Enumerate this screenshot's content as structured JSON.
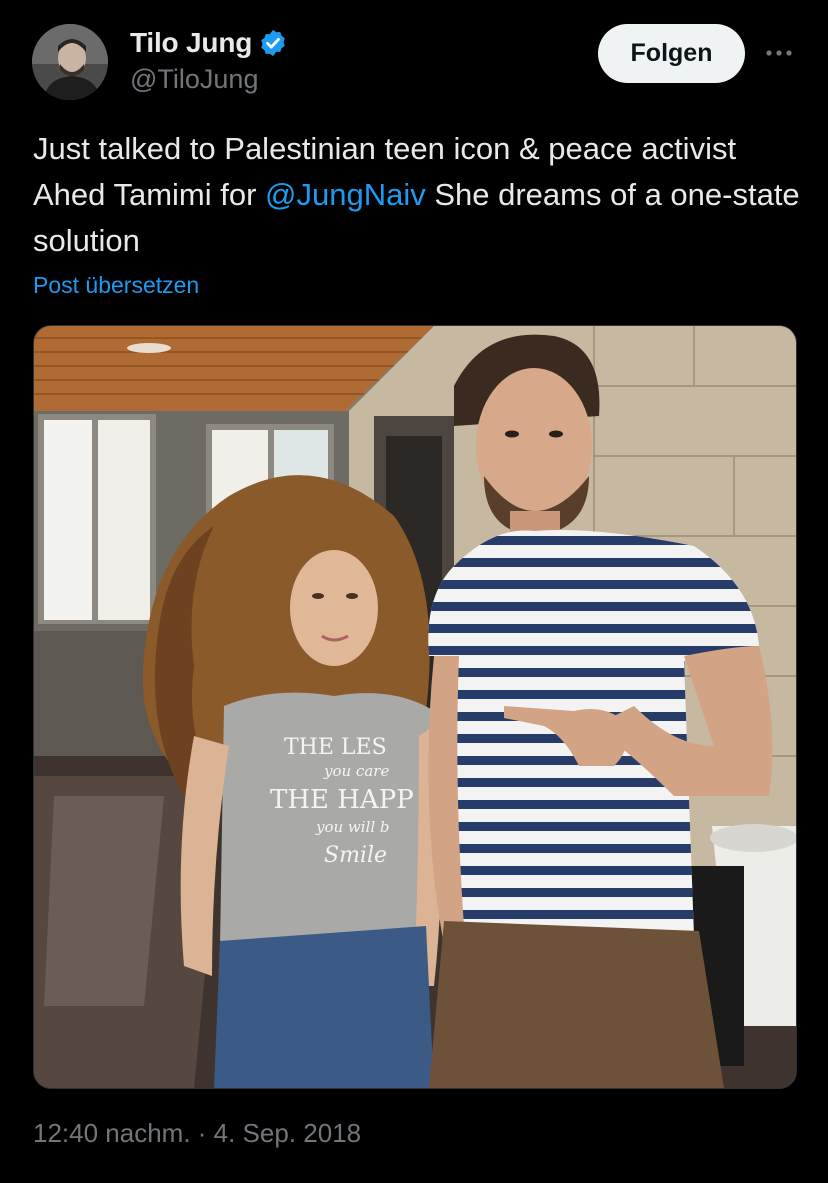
{
  "author": {
    "display_name": "Tilo Jung",
    "handle": "@TiloJung",
    "verified": true,
    "avatar_icon": "avatar-photo"
  },
  "actions": {
    "follow_label": "Folgen",
    "more_icon": "ellipsis-icon"
  },
  "post": {
    "text_before": "Just talked to Palestinian teen icon & peace activist Ahed Tamimi for ",
    "mention": "@JungNaiv",
    "text_after": " She dreams of a one-state solution",
    "translate_label": "Post übersetzen"
  },
  "media": {
    "shirt_text": [
      "THE LES",
      "you care",
      "THE HAPP",
      "you will b",
      "Smile"
    ]
  },
  "meta": {
    "timestamp": "12:40 nachm. · 4. Sep. 2018"
  },
  "colors": {
    "background": "#000000",
    "text": "#e7e9ea",
    "secondary": "#71767b",
    "accent": "#1d9bf0"
  }
}
